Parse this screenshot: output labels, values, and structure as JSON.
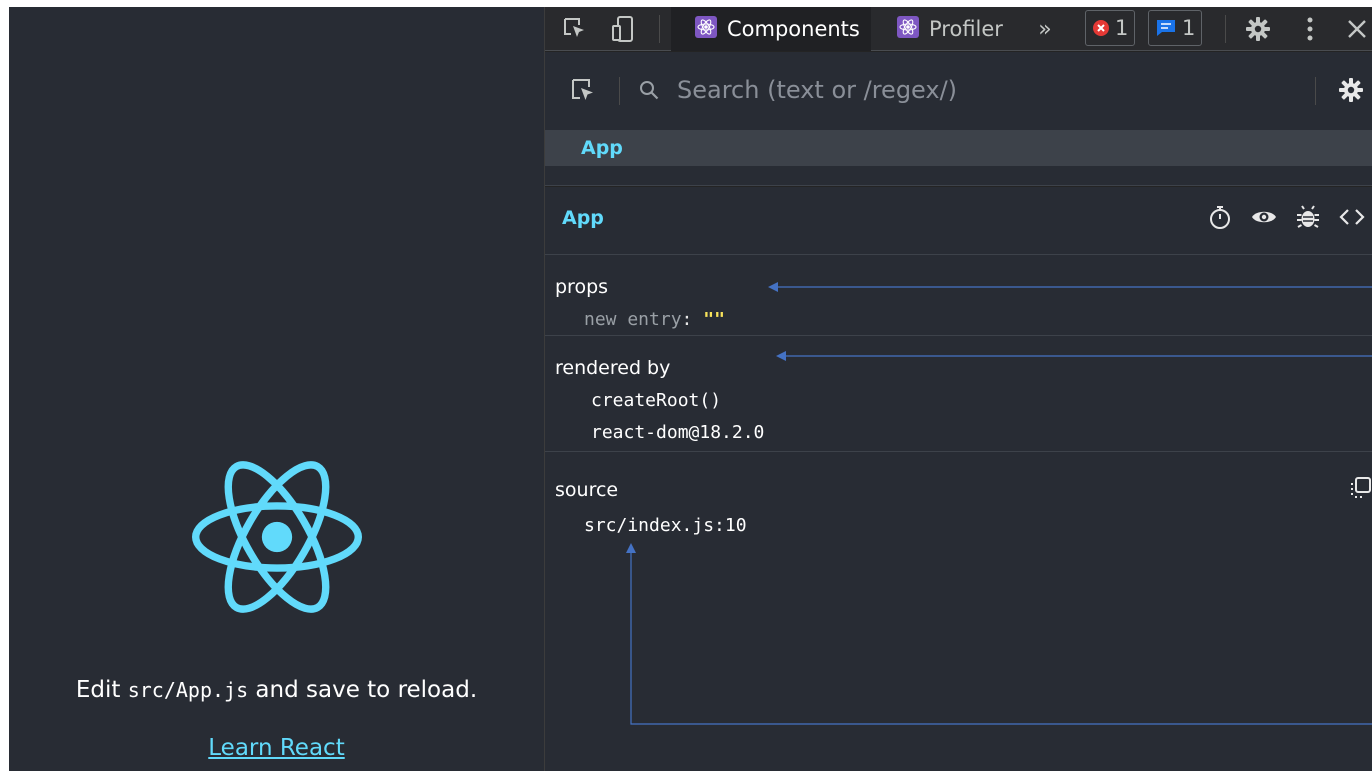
{
  "app": {
    "edit_prefix": "Edit ",
    "edit_code": "src/App.js",
    "edit_suffix": " and save to reload.",
    "link_label": "Learn React",
    "accent": "#61dafb"
  },
  "devtools": {
    "tabs": [
      {
        "label": "Components",
        "icon": "react-icon",
        "active": true
      },
      {
        "label": "Profiler",
        "icon": "react-icon",
        "active": false
      }
    ],
    "error_count": "1",
    "message_count": "1",
    "search_placeholder": "Search (text or /regex/)",
    "tree": {
      "selected": "App"
    },
    "inspector": {
      "title": "App",
      "props": {
        "title": "props",
        "entry_key": "new entry",
        "entry_value": "\"\""
      },
      "rendered_by": {
        "title": "rendered by",
        "items": [
          "createRoot()",
          "react-dom@18.2.0"
        ]
      },
      "source": {
        "title": "source",
        "location": "src/index.js:10"
      }
    }
  },
  "colors": {
    "annotation_arrow": "#4472c4",
    "error_badge": "#e53935",
    "message_badge": "#1a73e8"
  }
}
